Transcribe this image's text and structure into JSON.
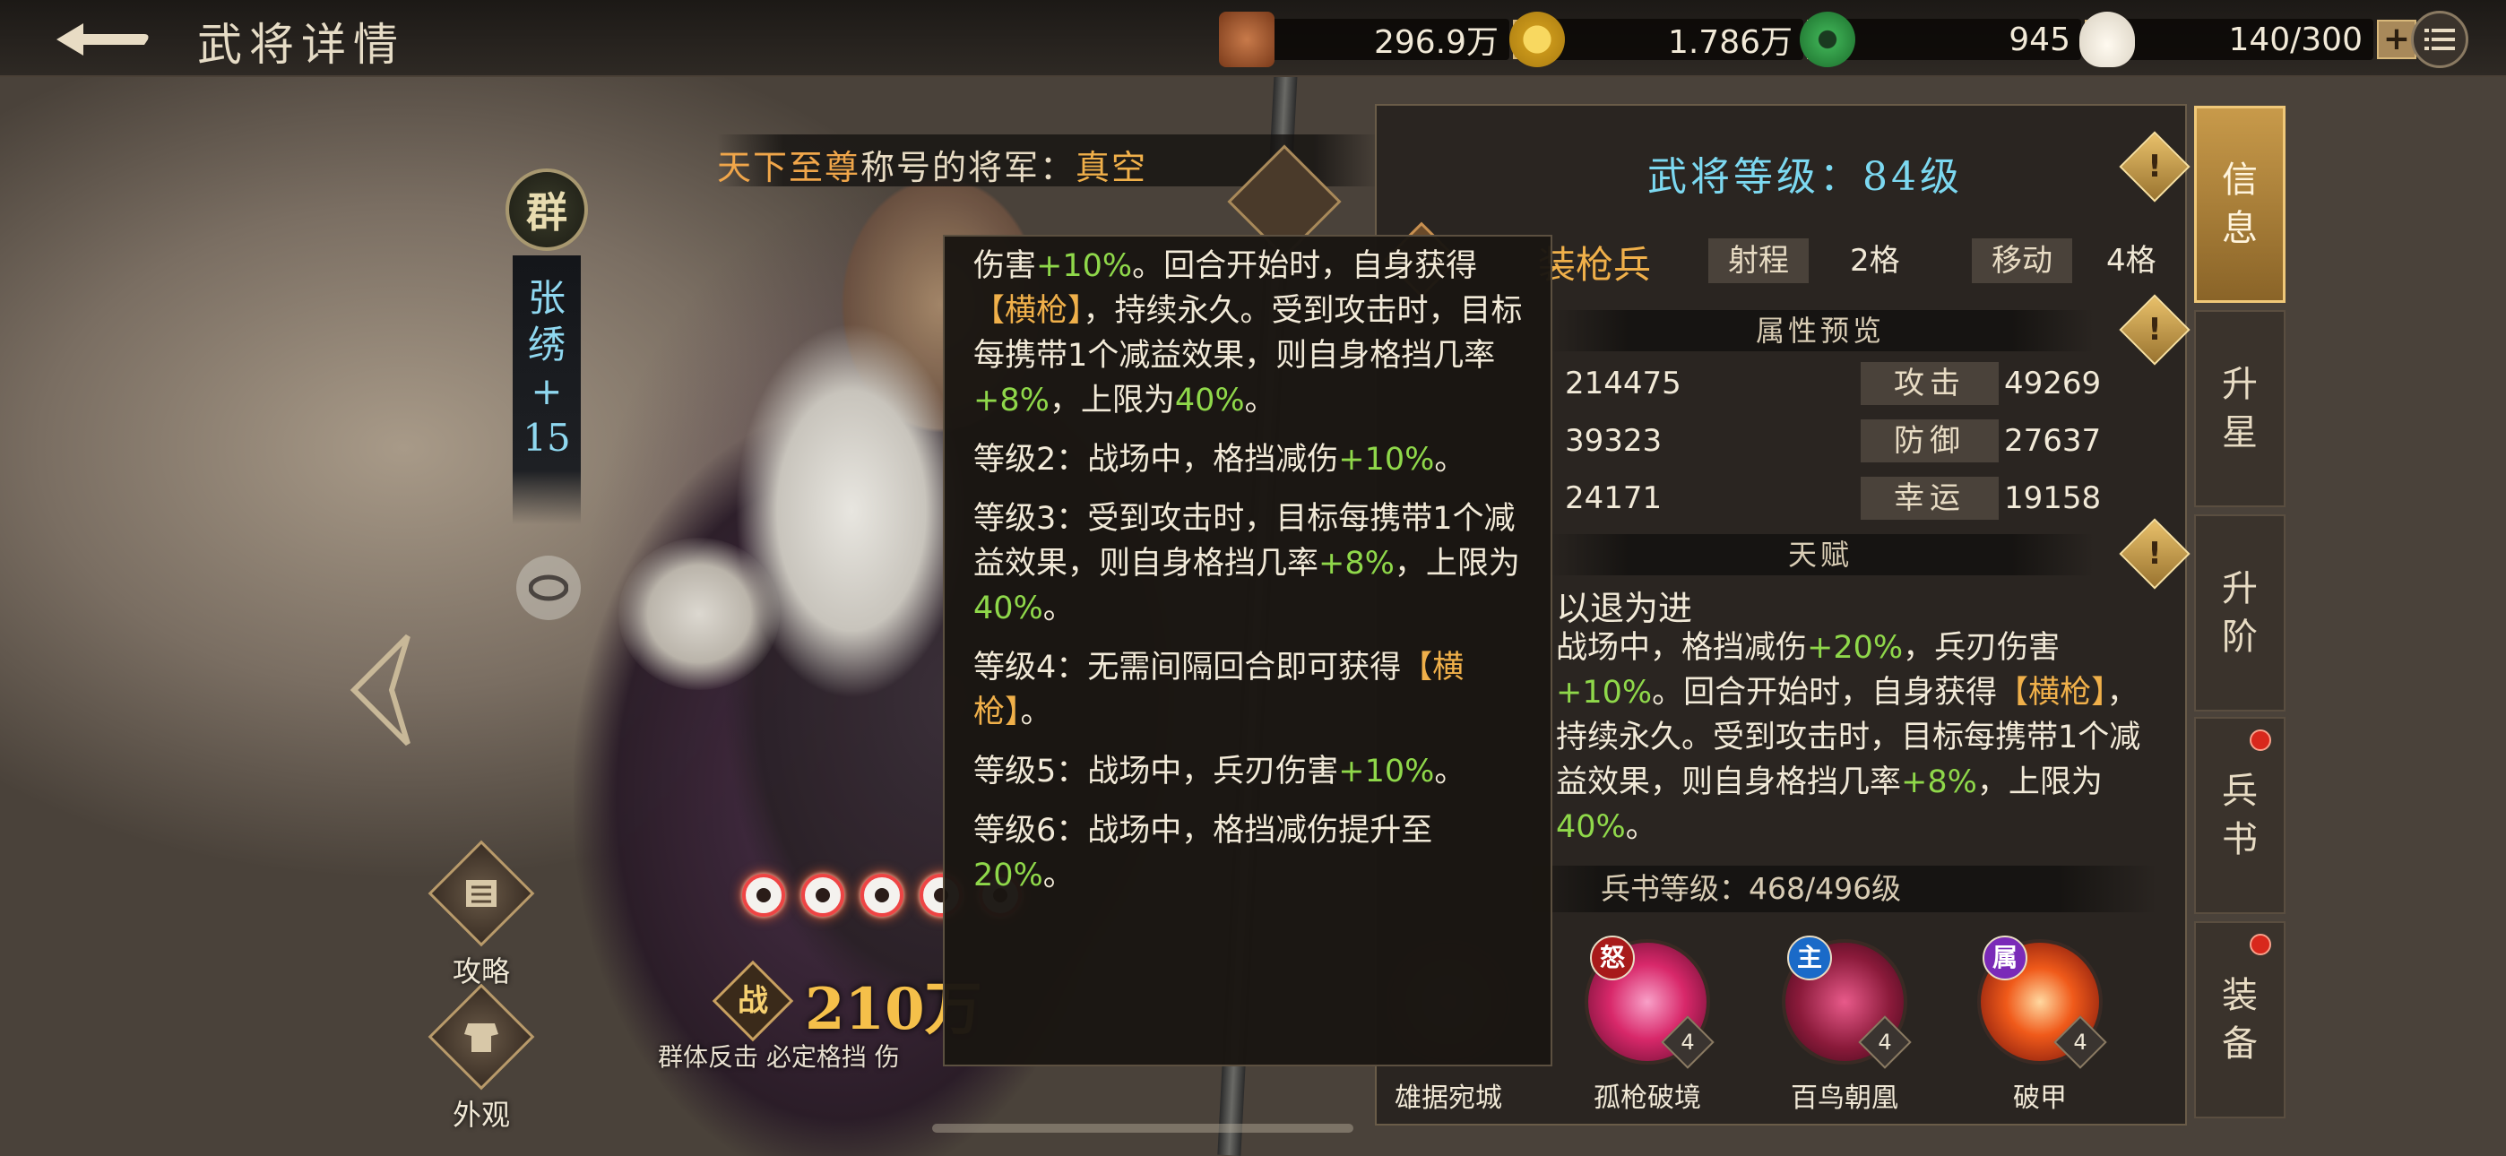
{
  "header": {
    "title": "武将详情",
    "currencies": [
      {
        "icon": "copper-coin-icon",
        "value": "296.9万"
      },
      {
        "icon": "gold-coin-icon",
        "value": "1.786万"
      },
      {
        "icon": "jade-icon",
        "value": "945"
      },
      {
        "icon": "steamed-bun-icon",
        "value": "140/300"
      }
    ],
    "plus": "+"
  },
  "hero": {
    "faction": "群",
    "name_chars": [
      "张",
      "绣",
      "+",
      "15"
    ],
    "title_prefix": "天下至尊",
    "title_mid": "称号的将军：",
    "title_holder": "真空",
    "power_badge": "战",
    "power_value": "210万",
    "skill_caption": "群体反击 必定格挡 伤",
    "stars": 5
  },
  "side_buttons": {
    "guide": "攻略",
    "appearance": "外观"
  },
  "panel": {
    "level_label": "武将等级：",
    "level_value": "84级",
    "exclaim": "!",
    "troop_type": "装枪兵",
    "range_label": "射程",
    "range_value": "2格",
    "move_label": "移动",
    "move_value": "4格",
    "attr_title": "属性预览",
    "stats": [
      {
        "left": "214475",
        "label": "攻击",
        "right": "49269"
      },
      {
        "left": "39323",
        "label": "防御",
        "right": "27637"
      },
      {
        "left": "24171",
        "label": "幸运",
        "right": "19158"
      }
    ],
    "talent_title": "天赋",
    "talent_name": "以退为进",
    "talent_desc": {
      "p1": "战场中，格挡减伤",
      "v1": "+20%",
      "p2": "，兵刃伤害",
      "v2": "+10%",
      "p3": "。回合开始时，自身获得",
      "kw": "【横枪】",
      "p4": "，持续永久。受到攻击时，目标每携带1个减益效果，则自身格挡几率",
      "v3": "+8%",
      "p5": "，上限为",
      "v4": "40%",
      "p6": "。"
    },
    "book_level_label": "兵书等级：",
    "book_level_value": "468/496级",
    "books": [
      {
        "name": "雄据宛城",
        "tag": "",
        "count": ""
      },
      {
        "name": "孤枪破境",
        "tag": "怒",
        "count": "4"
      },
      {
        "name": "百鸟朝凰",
        "tag": "主",
        "count": "4"
      },
      {
        "name": "破甲",
        "tag": "属",
        "count": "4"
      }
    ]
  },
  "tabs": [
    {
      "label": [
        "信",
        "息"
      ],
      "active": true,
      "badge": false
    },
    {
      "label": [
        "升",
        "星"
      ],
      "active": false,
      "badge": false
    },
    {
      "label": [
        "升",
        "阶"
      ],
      "active": false,
      "badge": false
    },
    {
      "label": [
        "兵",
        "书"
      ],
      "active": false,
      "badge": true
    },
    {
      "label": [
        "装",
        "备"
      ],
      "active": false,
      "badge": true
    }
  ],
  "tooltip": {
    "l1a": "伤害",
    "l1b": "+10%",
    "l1c": "。回合开始时，自身获得",
    "l1kw": "【横枪】",
    "l1d": "，持续永久。受到攻击时，目标每携带1个减益效果，则自身格挡几率",
    "l1e": "+8%",
    "l1f": "，上限为",
    "l1g": "40%",
    "l1h": "。",
    "lv2a": "等级2：战场中，格挡减伤",
    "lv2b": "+10%",
    "lv2c": "。",
    "lv3a": "等级3：受到攻击时，目标每携带1个减益效果，则自身格挡几率",
    "lv3b": "+8%",
    "lv3c": "，上限为",
    "lv3d": "40%",
    "lv3e": "。",
    "lv4a": "等级4：无需间隔回合即可获得",
    "lv4kw": "【横枪】",
    "lv4b": "。",
    "lv5a": "等级5：战场中，兵刃伤害",
    "lv5b": "+10%",
    "lv5c": "。",
    "lv6a": "等级6：战场中，格挡减伤提升至",
    "lv6b": "20%",
    "lv6c": "。"
  }
}
